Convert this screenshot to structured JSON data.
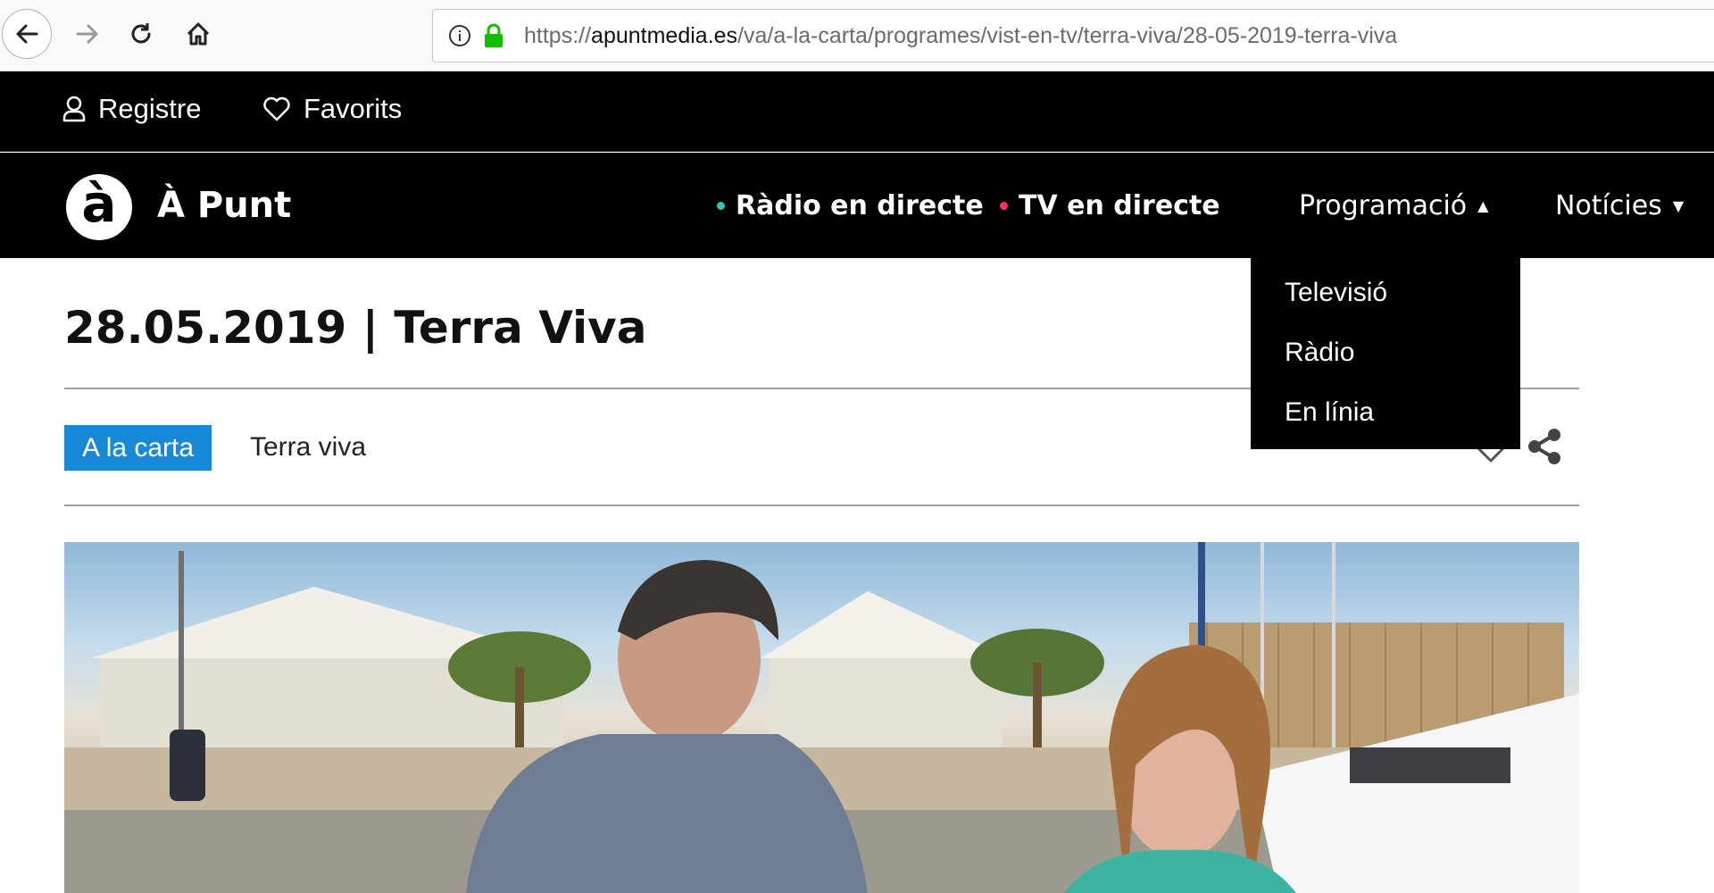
{
  "browser": {
    "url_prefix": "https://",
    "url_domain": "apuntmedia.es",
    "url_path": "/va/a-la-carta/programes/vist-en-tv/terra-viva/28-05-2019-terra-viva"
  },
  "top_bar": {
    "registre_label": "Registre",
    "favorits_label": "Favorits"
  },
  "main_nav": {
    "logo_glyph": "à",
    "logo_text": "À Punt",
    "radio_label": "Ràdio en directe",
    "tv_label": "TV en directe",
    "programacio_label": "Programació",
    "noticies_label": "Notícies",
    "radio_dot_color": "#2ec4b6",
    "tv_dot_color": "#ff2e63"
  },
  "dropdown": {
    "items": [
      "Televisió",
      "Ràdio",
      "En línia"
    ]
  },
  "content": {
    "title": "28.05.2019 | Terra Viva",
    "tag_label": "A la carta",
    "program_label": "Terra viva",
    "accent_color": "#1789d8"
  },
  "icons": {
    "back": "arrow-left-icon",
    "forward": "arrow-right-icon",
    "reload": "reload-icon",
    "home": "home-icon",
    "info": "info-icon",
    "lock": "lock-icon",
    "user": "user-icon",
    "heart": "heart-icon",
    "share": "share-icon"
  }
}
